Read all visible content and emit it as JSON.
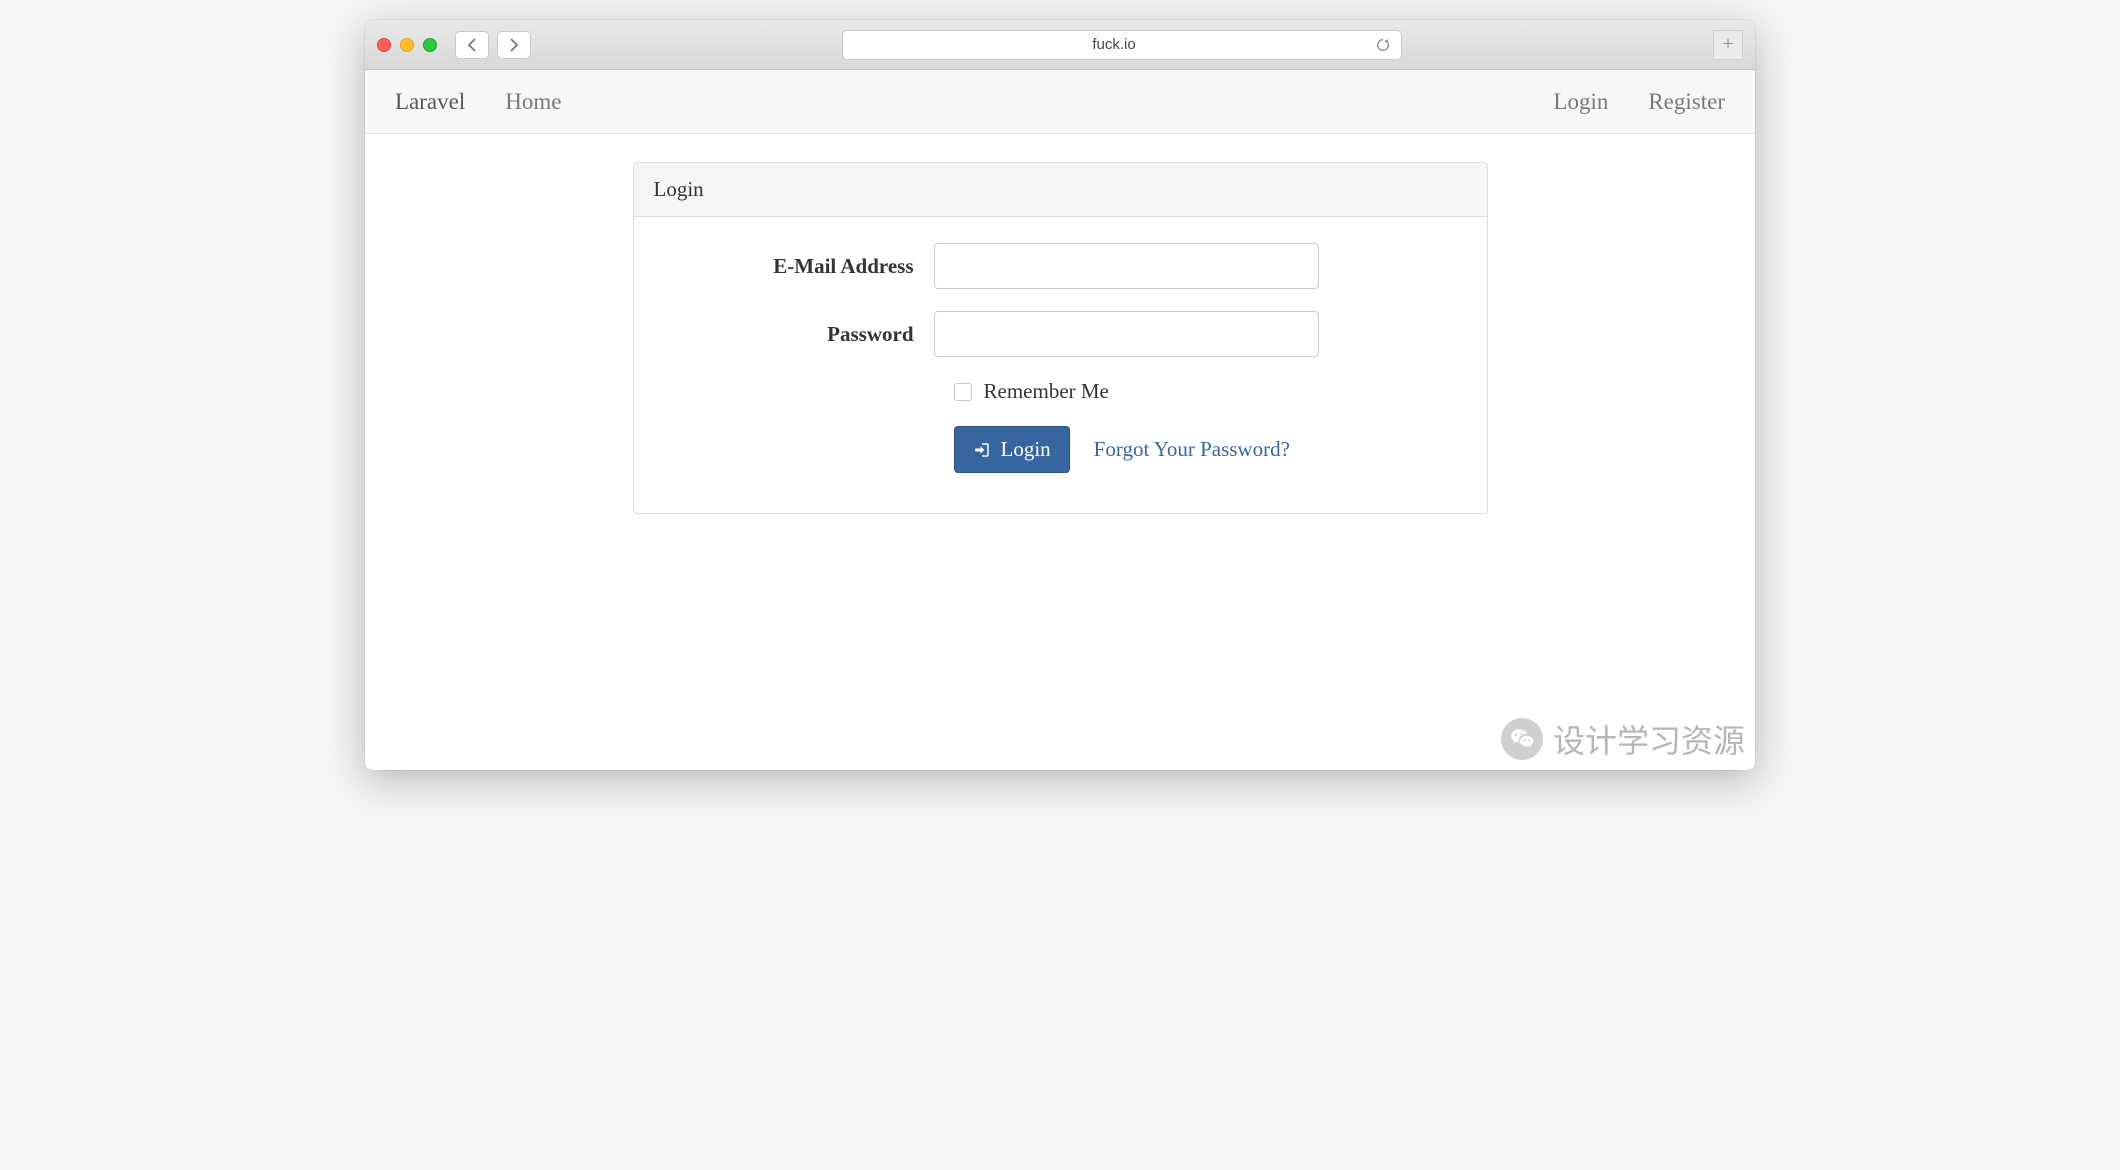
{
  "browser": {
    "url": "fuck.io"
  },
  "nav": {
    "brand": "Laravel",
    "home": "Home",
    "login": "Login",
    "register": "Register"
  },
  "panel": {
    "title": "Login"
  },
  "form": {
    "email_label": "E-Mail Address",
    "email_value": "",
    "password_label": "Password",
    "password_value": "",
    "remember_label": "Remember Me",
    "submit_label": "Login",
    "forgot_label": "Forgot Your Password?"
  },
  "watermark": {
    "text": "设计学习资源"
  }
}
